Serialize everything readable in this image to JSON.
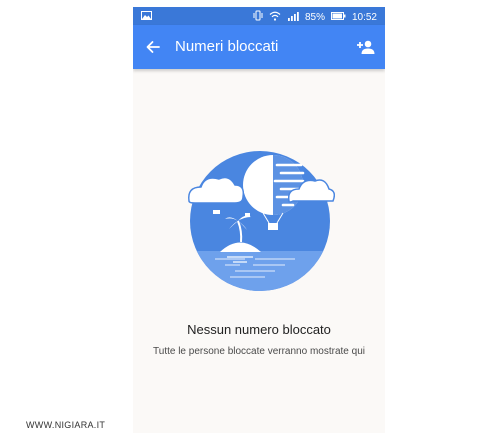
{
  "status_bar": {
    "battery_percent": "85%",
    "time": "10:52",
    "icons": [
      "photo-icon",
      "vibrate-icon",
      "wifi-icon",
      "signal-icon",
      "battery-icon"
    ]
  },
  "app_bar": {
    "title": "Numeri bloccati",
    "back_icon": "back-arrow-icon",
    "action_icon": "add-person-icon"
  },
  "empty_state": {
    "title": "Nessun numero bloccato",
    "subtitle": "Tutte le persone bloccate verranno mostrate qui"
  },
  "watermark": "WWW.NIGIARA.IT",
  "colors": {
    "app_bar": "#4285f4",
    "status_bar": "#3a78d8",
    "background": "#fbf9f7",
    "illustration_blue": "#4a86e0"
  }
}
